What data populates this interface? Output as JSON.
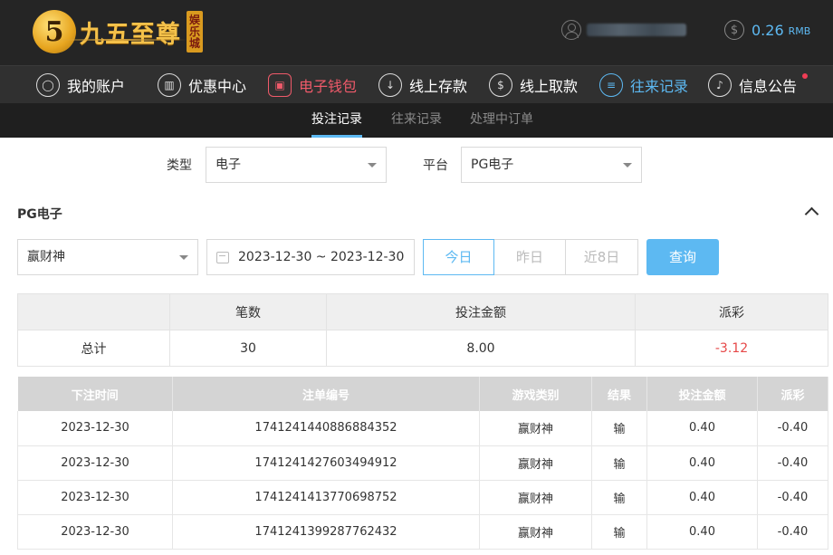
{
  "header": {
    "logo_number": "5",
    "logo_text": "九五至尊",
    "logo_seal": [
      "娱",
      "乐",
      "城"
    ],
    "balance": "0.26",
    "balance_unit": "RMB"
  },
  "nav": [
    {
      "label": "我的账户",
      "icon": "user-circle-icon"
    },
    {
      "label": "优惠中心",
      "icon": "gift-icon"
    },
    {
      "label": "电子钱包",
      "icon": "wallet-icon"
    },
    {
      "label": "线上存款",
      "icon": "deposit-icon"
    },
    {
      "label": "线上取款",
      "icon": "withdraw-icon"
    },
    {
      "label": "往来记录",
      "icon": "records-icon"
    },
    {
      "label": "信息公告",
      "icon": "bell-icon"
    }
  ],
  "subnav": [
    "投注记录",
    "往来记录",
    "处理中订单"
  ],
  "filters": {
    "type_label": "类型",
    "type_value": "电子",
    "platform_label": "平台",
    "platform_value": "PG电子"
  },
  "section_title": "PG电子",
  "query": {
    "game_value": "赢财神",
    "date_range": "2023-12-30 ~ 2023-12-30",
    "quick": [
      "今日",
      "昨日",
      "近8日"
    ],
    "button": "查询"
  },
  "summary": {
    "headers": [
      "",
      "笔数",
      "投注金额",
      "派彩"
    ],
    "row_label": "总计",
    "count": "30",
    "bet": "8.00",
    "payout": "-3.12"
  },
  "records": {
    "headers": [
      "下注时间",
      "注单编号",
      "游戏类别",
      "结果",
      "投注金额",
      "派彩"
    ],
    "rows": [
      [
        "2023-12-30",
        "1741241440886884352",
        "赢财神",
        "输",
        "0.40",
        "-0.40"
      ],
      [
        "2023-12-30",
        "1741241427603494912",
        "赢财神",
        "输",
        "0.40",
        "-0.40"
      ],
      [
        "2023-12-30",
        "1741241413770698752",
        "赢财神",
        "输",
        "0.40",
        "-0.40"
      ],
      [
        "2023-12-30",
        "1741241399287762432",
        "赢财神",
        "输",
        "0.40",
        "-0.40"
      ]
    ]
  },
  "colors": {
    "accent_blue": "#5db9f2",
    "accent_red": "#ef5a6a",
    "negative": "#e64848"
  }
}
